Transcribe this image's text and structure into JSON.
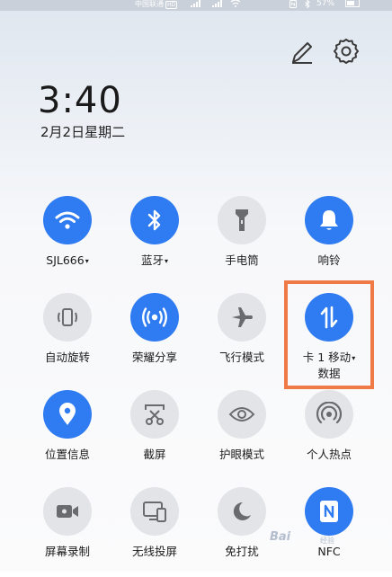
{
  "status_bar": {
    "carrier": "中国联通",
    "carrier_badge": "HD",
    "battery": "57%",
    "icons": [
      "signal-icon",
      "signal-icon",
      "wifi-icon",
      "nfc-icon",
      "bluetooth-icon",
      "battery-icon"
    ]
  },
  "header": {
    "time": "3:40",
    "date": "2月2日星期二",
    "icons": [
      "edit-icon",
      "settings-gear-icon"
    ]
  },
  "tiles": [
    {
      "label": "SJL666",
      "caret": "▾",
      "state": "on",
      "icon": "wifi-icon"
    },
    {
      "label": "蓝牙",
      "caret": "▾",
      "state": "on",
      "icon": "bluetooth-icon"
    },
    {
      "label": "手电筒",
      "state": "off",
      "icon": "flashlight-icon"
    },
    {
      "label": "响铃",
      "state": "on",
      "icon": "bell-icon"
    },
    {
      "label": "自动旋转",
      "state": "off",
      "icon": "auto-rotate-icon"
    },
    {
      "label": "荣耀分享",
      "state": "on",
      "icon": "share-broadcast-icon"
    },
    {
      "label": "飞行模式",
      "state": "off",
      "icon": "airplane-icon"
    },
    {
      "label": "卡 1 移动",
      "caret": "▾",
      "label2": "数据",
      "state": "on",
      "icon": "mobile-data-icon"
    },
    {
      "label": "位置信息",
      "state": "on",
      "icon": "location-icon"
    },
    {
      "label": "截屏",
      "state": "off",
      "icon": "screenshot-scissors-icon"
    },
    {
      "label": "护眼模式",
      "state": "off",
      "icon": "eye-icon"
    },
    {
      "label": "个人热点",
      "state": "off",
      "icon": "hotspot-icon"
    },
    {
      "label": "屏幕录制",
      "state": "off",
      "icon": "screen-record-icon"
    },
    {
      "label": "无线投屏",
      "state": "off",
      "icon": "wireless-projection-icon"
    },
    {
      "label": "免打扰",
      "state": "off",
      "icon": "moon-icon"
    },
    {
      "label": "NFC",
      "state": "on",
      "icon": "nfc-icon"
    }
  ],
  "watermark": {
    "text": "Bai",
    "suffix": "经验"
  },
  "colors": {
    "accent": "#2f7bf1",
    "tile_off": "#e3e4e7",
    "highlight": "#f07a45"
  }
}
